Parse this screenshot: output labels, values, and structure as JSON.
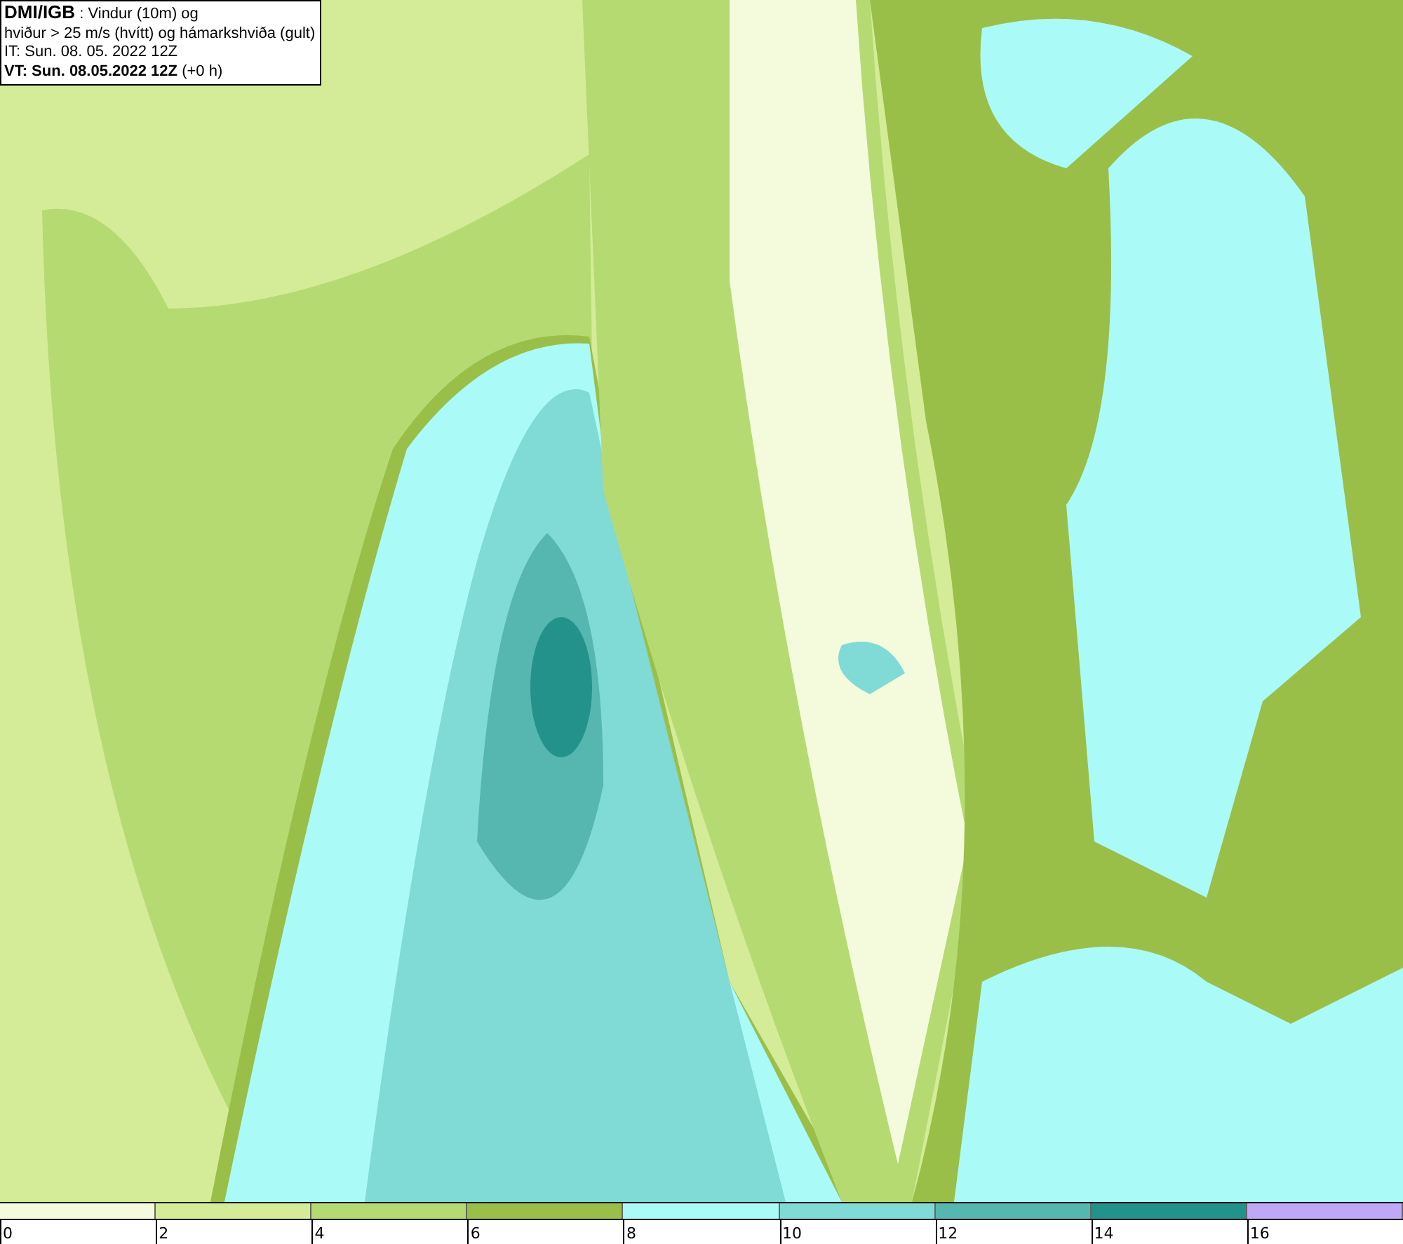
{
  "header": {
    "lines": [
      "**DMI/IGB** : Vindur (10m) og",
      "hviður > 25 m/s (hvítt) og hámarkshviða (gult)",
      "IT: Sun. 08. 05. 2022 12Z",
      "**VT: Sun. 08.05.2022 12Z** (+0 h)"
    ]
  },
  "legend": [
    {
      "label": "0",
      "color": "#f4fbdc"
    },
    {
      "label": "2",
      "color": "#d4ec98"
    },
    {
      "label": "4",
      "color": "#b6da72"
    },
    {
      "label": "6",
      "color": "#9abf48"
    },
    {
      "label": "8",
      "color": "#aafaf8"
    },
    {
      "label": "10",
      "color": "#80dad6"
    },
    {
      "label": "12",
      "color": "#56b6b0"
    },
    {
      "label": "14",
      "color": "#23928a"
    },
    {
      "label": "16",
      "color": "#c0a8f6"
    }
  ]
}
